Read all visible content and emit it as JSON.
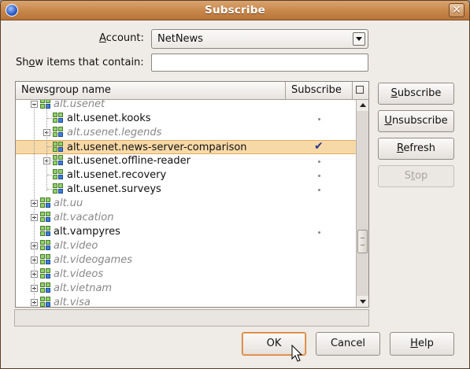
{
  "window": {
    "title": "Subscribe"
  },
  "account": {
    "label_pre": "",
    "label_accel": "A",
    "label_post": "ccount:",
    "value": "NetNews"
  },
  "filter": {
    "label_pre": "Sh",
    "label_accel": "o",
    "label_post": "w items that contain:",
    "value": ""
  },
  "columns": {
    "name": "Newsgroup name",
    "subscribe": "Subscribe"
  },
  "rows": [
    {
      "name": "alt.usenet",
      "italic": true,
      "expander": "minus",
      "subscribed": "none"
    },
    {
      "name": "alt.usenet.kooks",
      "italic": false,
      "expander": "",
      "subscribed": "dot"
    },
    {
      "name": "alt.usenet.legends",
      "italic": true,
      "expander": "plus",
      "subscribed": "none"
    },
    {
      "name": "alt.usenet.news-server-comparison",
      "italic": false,
      "expander": "",
      "subscribed": "check",
      "selected": true
    },
    {
      "name": "alt.usenet.offline-reader",
      "italic": false,
      "expander": "plus",
      "subscribed": "dot"
    },
    {
      "name": "alt.usenet.recovery",
      "italic": false,
      "expander": "",
      "subscribed": "dot"
    },
    {
      "name": "alt.usenet.surveys",
      "italic": false,
      "expander": "",
      "subscribed": "dot"
    },
    {
      "name": "alt.uu",
      "italic": true,
      "expander": "plus",
      "subscribed": "none"
    },
    {
      "name": "alt.vacation",
      "italic": true,
      "expander": "plus",
      "subscribed": "none"
    },
    {
      "name": "alt.vampyres",
      "italic": false,
      "expander": "",
      "subscribed": "dot"
    },
    {
      "name": "alt.video",
      "italic": true,
      "expander": "plus",
      "subscribed": "none"
    },
    {
      "name": "alt.videogames",
      "italic": true,
      "expander": "plus",
      "subscribed": "none"
    },
    {
      "name": "alt.videos",
      "italic": true,
      "expander": "plus",
      "subscribed": "none"
    },
    {
      "name": "alt.vietnam",
      "italic": true,
      "expander": "plus",
      "subscribed": "none"
    },
    {
      "name": "alt.visa",
      "italic": true,
      "expander": "plus",
      "subscribed": "none"
    }
  ],
  "side_buttons": {
    "subscribe": {
      "pre": "",
      "accel": "S",
      "post": "ubscribe"
    },
    "unsubscribe": {
      "pre": "",
      "accel": "U",
      "post": "nsubscribe"
    },
    "refresh": {
      "pre": "",
      "accel": "R",
      "post": "efresh"
    },
    "stop": {
      "pre": "S",
      "accel": "t",
      "post": "op"
    }
  },
  "footer_buttons": {
    "ok": "OK",
    "cancel": "Cancel",
    "help": {
      "pre": "",
      "accel": "H",
      "post": "elp"
    }
  },
  "status": {
    "text": ""
  }
}
